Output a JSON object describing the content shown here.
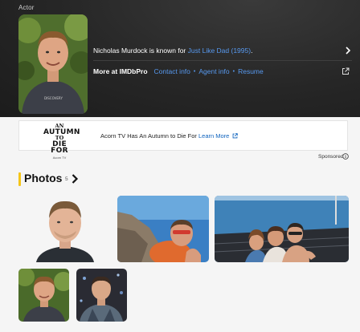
{
  "hero": {
    "role": "Actor",
    "known_prefix": "Nicholas Murdock is known for ",
    "known_title": "Just Like Dad (1995)",
    "known_suffix": ".",
    "more_label": "More at IMDbPro",
    "links": [
      "Contact info",
      "Agent info",
      "Resume"
    ],
    "separator": "•",
    "icons": [
      "chevron-right-icon",
      "external-link-icon"
    ]
  },
  "ad": {
    "logo_lines": [
      "AN",
      "AUTUMN",
      "TO",
      "DIE FOR",
      "Acorn TV"
    ],
    "text": "Acorn TV Has An Autumn to Die For ",
    "link": "Learn More",
    "sponsored": "Sponsored",
    "icons": [
      "external-link-icon",
      "info-icon"
    ]
  },
  "photos": {
    "title": "Photos",
    "count": "5",
    "accent": "#f5c518",
    "icons": [
      "chevron-right-icon"
    ]
  },
  "colors": {
    "hero_bg": "#262626",
    "link_dark": "#5799ef",
    "link_light": "#0e63be",
    "page_bg": "#f5f5f5"
  }
}
